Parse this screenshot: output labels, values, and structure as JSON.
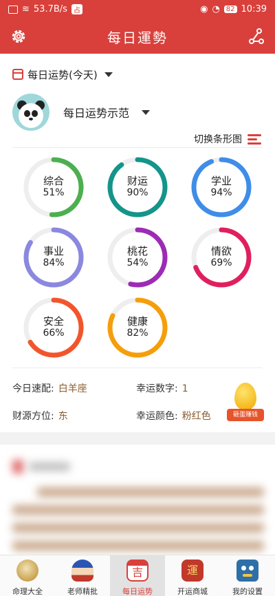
{
  "status_bar": {
    "network_speed": "53.7B/s",
    "app_badge": "占",
    "battery": "82",
    "time": "10:39"
  },
  "app_bar": {
    "title": "每日運勢",
    "settings_icon": "gear-icon",
    "share_icon": "share-icon"
  },
  "selector": {
    "label": "每日运势(今天)",
    "icon": "calendar-icon"
  },
  "profile": {
    "name": "每日运势示范",
    "avatar": "panda-avatar"
  },
  "switch_view": {
    "label": "切换条形图",
    "icon": "bars-icon"
  },
  "fortune": [
    {
      "label": "综合",
      "value": 51,
      "display": "51%",
      "color": "#4caf50"
    },
    {
      "label": "财运",
      "value": 90,
      "display": "90%",
      "color": "#14948a"
    },
    {
      "label": "学业",
      "value": 94,
      "display": "94%",
      "color": "#3f8de8"
    },
    {
      "label": "事业",
      "value": 84,
      "display": "84%",
      "color": "#8b88e0"
    },
    {
      "label": "桃花",
      "value": 54,
      "display": "54%",
      "color": "#9c2bb5"
    },
    {
      "label": "情欲",
      "value": 69,
      "display": "69%",
      "color": "#e01f5e"
    },
    {
      "label": "安全",
      "value": 66,
      "display": "66%",
      "color": "#f2552c"
    },
    {
      "label": "健康",
      "value": 82,
      "display": "82%",
      "color": "#f59e0b"
    }
  ],
  "info": {
    "match_label": "今日速配:",
    "match_value": "白羊座",
    "number_label": "幸运数字:",
    "number_value": "1",
    "direction_label": "财源方位:",
    "direction_value": "东",
    "color_label": "幸运颜色:",
    "color_value": "粉红色"
  },
  "egg": {
    "label": "砸蛋赚钱"
  },
  "tabs": [
    {
      "label": "命理大全",
      "icon": "bagua-icon"
    },
    {
      "label": "老师精批",
      "icon": "teacher-icon"
    },
    {
      "label": "每日运势",
      "icon": "calendar-ji-icon",
      "glyph": "吉"
    },
    {
      "label": "开运商城",
      "icon": "shop-icon",
      "glyph": "運"
    },
    {
      "label": "我的设置",
      "icon": "robot-icon"
    }
  ],
  "colors": {
    "brand": "#d9403b",
    "track": "#eeeeee",
    "value_text": "#8a5a2b"
  }
}
